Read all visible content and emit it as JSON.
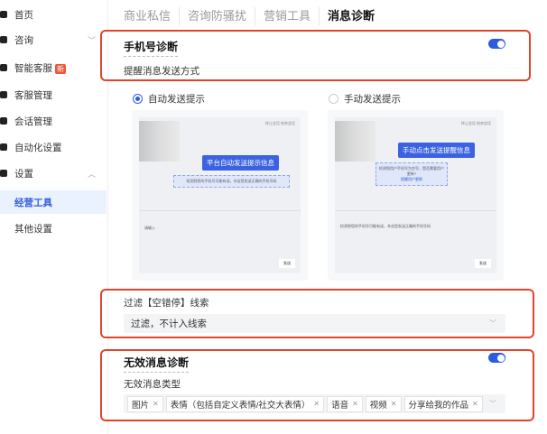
{
  "sidebar": {
    "items": [
      {
        "label": "首页",
        "icon": "home-icon"
      },
      {
        "label": "咨询",
        "icon": "chat-icon",
        "chevron": "down"
      },
      {
        "label": "智能客服",
        "icon": "robot-icon",
        "badge": "新"
      },
      {
        "label": "客服管理",
        "icon": "users-icon"
      },
      {
        "label": "会话管理",
        "icon": "session-icon"
      },
      {
        "label": "自动化设置",
        "icon": "automation-icon"
      },
      {
        "label": "设置",
        "icon": "settings-icon",
        "chevron": "up"
      },
      {
        "label": "经营工具",
        "active": true
      },
      {
        "label": "其他设置"
      }
    ]
  },
  "tabs": [
    "商业私信",
    "咨询防骚扰",
    "营销工具",
    "消息诊断"
  ],
  "phone_diag": {
    "title": "手机号诊断",
    "enabled": true,
    "subtitle": "提醒消息发送方式",
    "options": [
      {
        "label": "自动发送提示",
        "selected": true,
        "preview": {
          "header": "转让会话  结束会话",
          "highlight": "平台自动发送提示信息",
          "bubble": "检测到您的手机号可能有误，辛苦您发送正确的手机号码",
          "input_placeholder": "请输入",
          "send": "发送"
        }
      },
      {
        "label": "手动发送提示",
        "selected": false,
        "preview": {
          "header": "转让会话  结束会话",
          "highlight": "手动点击发送提醒信息",
          "bubble": "检测到用户手机号为空号，是否需要用户更新?",
          "bubble_link": "提醒用户更换",
          "input_text": "检测到您的手机号可能有误，辛苦您发送正确的手机号码",
          "send": "发送"
        }
      }
    ]
  },
  "filter": {
    "label": "过滤【空错停】线索",
    "value": "过滤，不计入线索"
  },
  "invalid_diag": {
    "title": "无效消息诊断",
    "enabled": true,
    "subtitle": "无效消息类型",
    "tags": [
      "图片",
      "表情（包括自定义表情/社交大表情）",
      "语音",
      "视频",
      "分享给我的作品"
    ]
  },
  "colors": {
    "accent": "#2d5bdc",
    "highlight_border": "#e0442c"
  }
}
